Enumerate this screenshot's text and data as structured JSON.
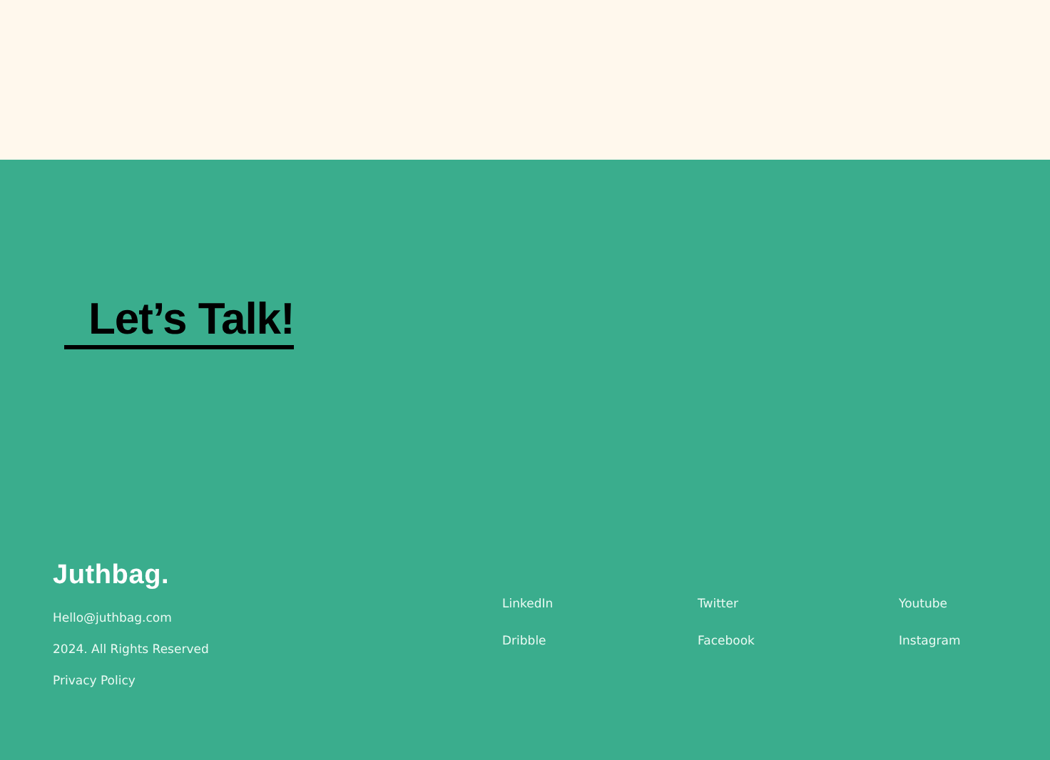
{
  "cta": {
    "label": "Let’s Talk!"
  },
  "footer": {
    "logo": "Juthbag.",
    "info": [
      "Hello@juthbag.com",
      "2024. All Rights Reserved",
      "Privacy Policy"
    ],
    "links": [
      [
        "LinkedIn",
        "Dribble"
      ],
      [
        "Twitter",
        "Facebook"
      ],
      [
        "Youtube",
        "Instagram"
      ]
    ]
  }
}
